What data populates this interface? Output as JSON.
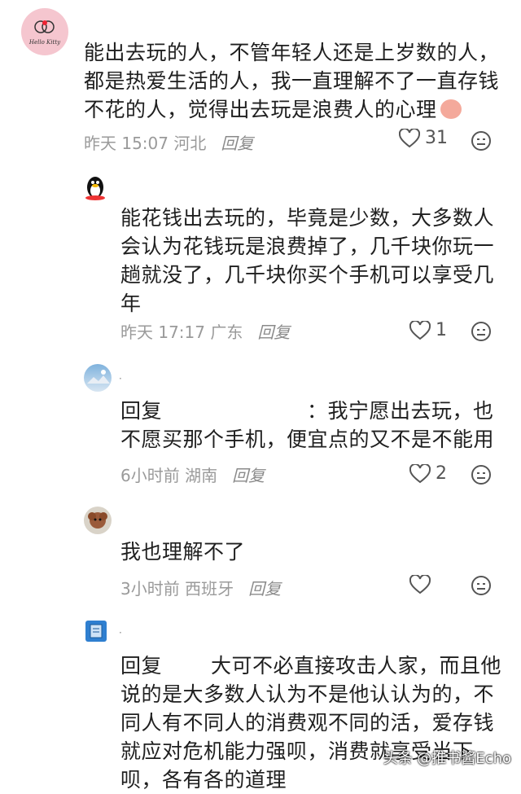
{
  "comments": [
    {
      "avatar": "hello-kitty-avatar",
      "avatar_text": "Hello Kitty",
      "lines": [
        "能出去玩的人，不管年轻人还是上岁数的人，",
        "都是热爱生活的人，我一直理解不了一直存钱",
        "不花的人，觉得出去玩是浪费人的心理"
      ],
      "time": "昨天 15:07 河北",
      "reply_label": "回复",
      "likes": "31"
    },
    {
      "avatar": "qq-penguin-avatar",
      "lines": [
        "能花钱出去玩的，毕竟是少数，大多数人",
        "会认为花钱玩是浪费掉了，几千块你玩一",
        "趟就没了，几千块你买个手机可以享受几",
        "年"
      ],
      "time": "昨天 17:17 广东",
      "reply_label": "回复",
      "likes": "1"
    },
    {
      "avatar": "sky-landscape-avatar",
      "name_mark": "·",
      "reply_prefix": "回复",
      "reply_target_sep": "：",
      "lines": [
        "我宁愿出去玩，也",
        "不愿买那个手机，便宜点的又不是不能用"
      ],
      "time": "6小时前 湖南",
      "reply_label": "回复",
      "likes": "2"
    },
    {
      "avatar": "dog-avatar",
      "lines": [
        "我也理解不了"
      ],
      "time": "3小时前 西班牙",
      "reply_label": "回复",
      "likes": ""
    },
    {
      "avatar": "book-icon-avatar",
      "name_mark": "·",
      "reply_prefix": "回复",
      "lines": [
        "大可不必直接攻击人家，而且他",
        "说的是大多数人认为不是他认认为的，不",
        "同人有不同人的消费观不同的活，爱存钱",
        "就应对危机能力强呗，消费就享受当下",
        "呗，各有各的道理"
      ],
      "time": "",
      "reply_label": "",
      "likes": ""
    }
  ],
  "watermark": "头条 @推书酱Echo",
  "colors": {
    "like_icon": "#555555",
    "meta": "#9a9a9a",
    "text": "#1f1f1f"
  }
}
